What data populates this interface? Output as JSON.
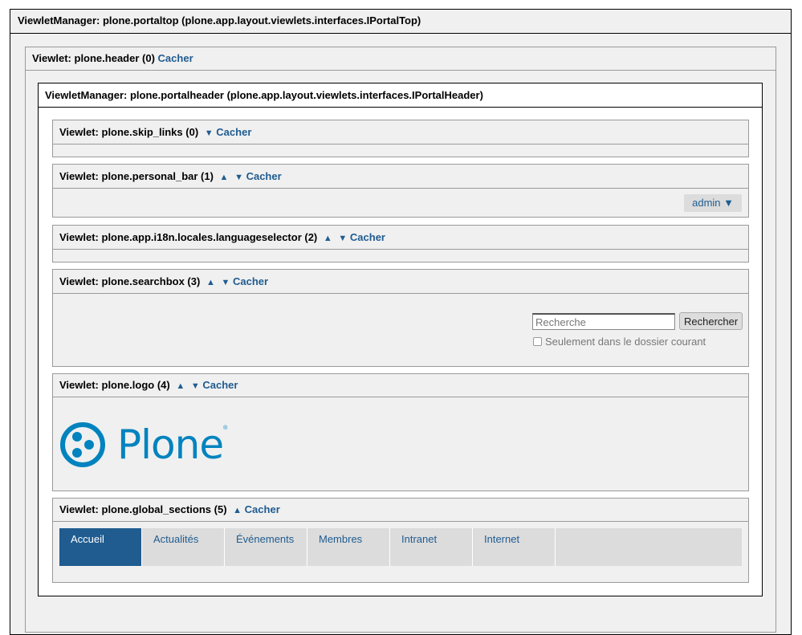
{
  "hide_label": "Cacher",
  "up_arrow": "▲",
  "down_arrow": "▼",
  "portaltop": {
    "title": "ViewletManager: plone.portaltop (plone.app.layout.viewlets.interfaces.IPortalTop)"
  },
  "header_viewlet": {
    "title": "Viewlet: plone.header (0)"
  },
  "portalheader": {
    "title": "ViewletManager: plone.portalheader (plone.app.layout.viewlets.interfaces.IPortalHeader)"
  },
  "skip_links": {
    "title": "Viewlet: plone.skip_links (0)"
  },
  "personal_bar": {
    "title": "Viewlet: plone.personal_bar (1)",
    "user_menu": "admin ▼"
  },
  "language_selector": {
    "title": "Viewlet: plone.app.i18n.locales.languageselector (2)"
  },
  "searchbox": {
    "title": "Viewlet: plone.searchbox (3)",
    "placeholder": "Recherche",
    "button_label": "Rechercher",
    "current_folder_label": "Seulement dans le dossier courant"
  },
  "logo": {
    "title": "Viewlet: plone.logo (4)",
    "text": "Plone"
  },
  "global_sections": {
    "title": "Viewlet: plone.global_sections (5)",
    "tabs": [
      "Accueil",
      "Actualités",
      "Événements",
      "Membres",
      "Intranet",
      "Internet"
    ]
  },
  "colors": {
    "link": "#205c90",
    "active_tab": "#205c90",
    "logo": "#0083be"
  }
}
